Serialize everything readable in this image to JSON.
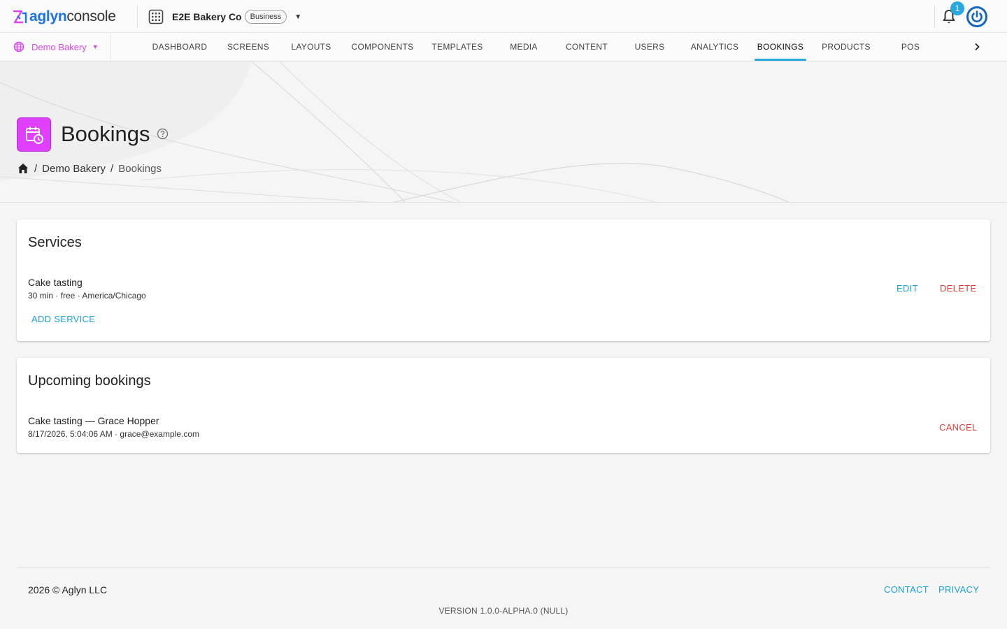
{
  "app": {
    "logo_brand": "aglyn",
    "logo_product": "console"
  },
  "org": {
    "name": "E2E Bakery Co",
    "plan_badge": "Business"
  },
  "notifications": {
    "count": "1"
  },
  "site": {
    "name": "Demo Bakery"
  },
  "nav": {
    "tabs": [
      {
        "label": "DASHBOARD"
      },
      {
        "label": "SCREENS"
      },
      {
        "label": "LAYOUTS"
      },
      {
        "label": "COMPONENTS"
      },
      {
        "label": "TEMPLATES"
      },
      {
        "label": "MEDIA"
      },
      {
        "label": "CONTENT"
      },
      {
        "label": "USERS"
      },
      {
        "label": "ANALYTICS"
      },
      {
        "label": "BOOKINGS"
      },
      {
        "label": "PRODUCTS"
      },
      {
        "label": "POS"
      }
    ],
    "active": "BOOKINGS"
  },
  "page": {
    "title": "Bookings",
    "breadcrumb": [
      "Demo Bakery",
      "Bookings"
    ]
  },
  "services": {
    "title": "Services",
    "items": [
      {
        "name": "Cake tasting",
        "details": "30 min · free · America/Chicago",
        "edit_label": "EDIT",
        "delete_label": "DELETE"
      }
    ],
    "add_label": "ADD SERVICE"
  },
  "bookings": {
    "title": "Upcoming bookings",
    "items": [
      {
        "title": "Cake tasting — Grace Hopper",
        "details": "8/17/2026, 5:04:06 AM · grace@example.com",
        "cancel_label": "CANCEL"
      }
    ]
  },
  "footer": {
    "copyright": "2026 © Aglyn LLC",
    "contact_label": "CONTACT",
    "privacy_label": "PRIVACY",
    "version": "VERSION 1.0.0-ALPHA.0 (NULL)"
  },
  "colors": {
    "accent_blue": "#1aa0dc",
    "brand_magenta": "#d946ef",
    "danger_red": "#e53935",
    "power_blue": "#1565c0"
  }
}
